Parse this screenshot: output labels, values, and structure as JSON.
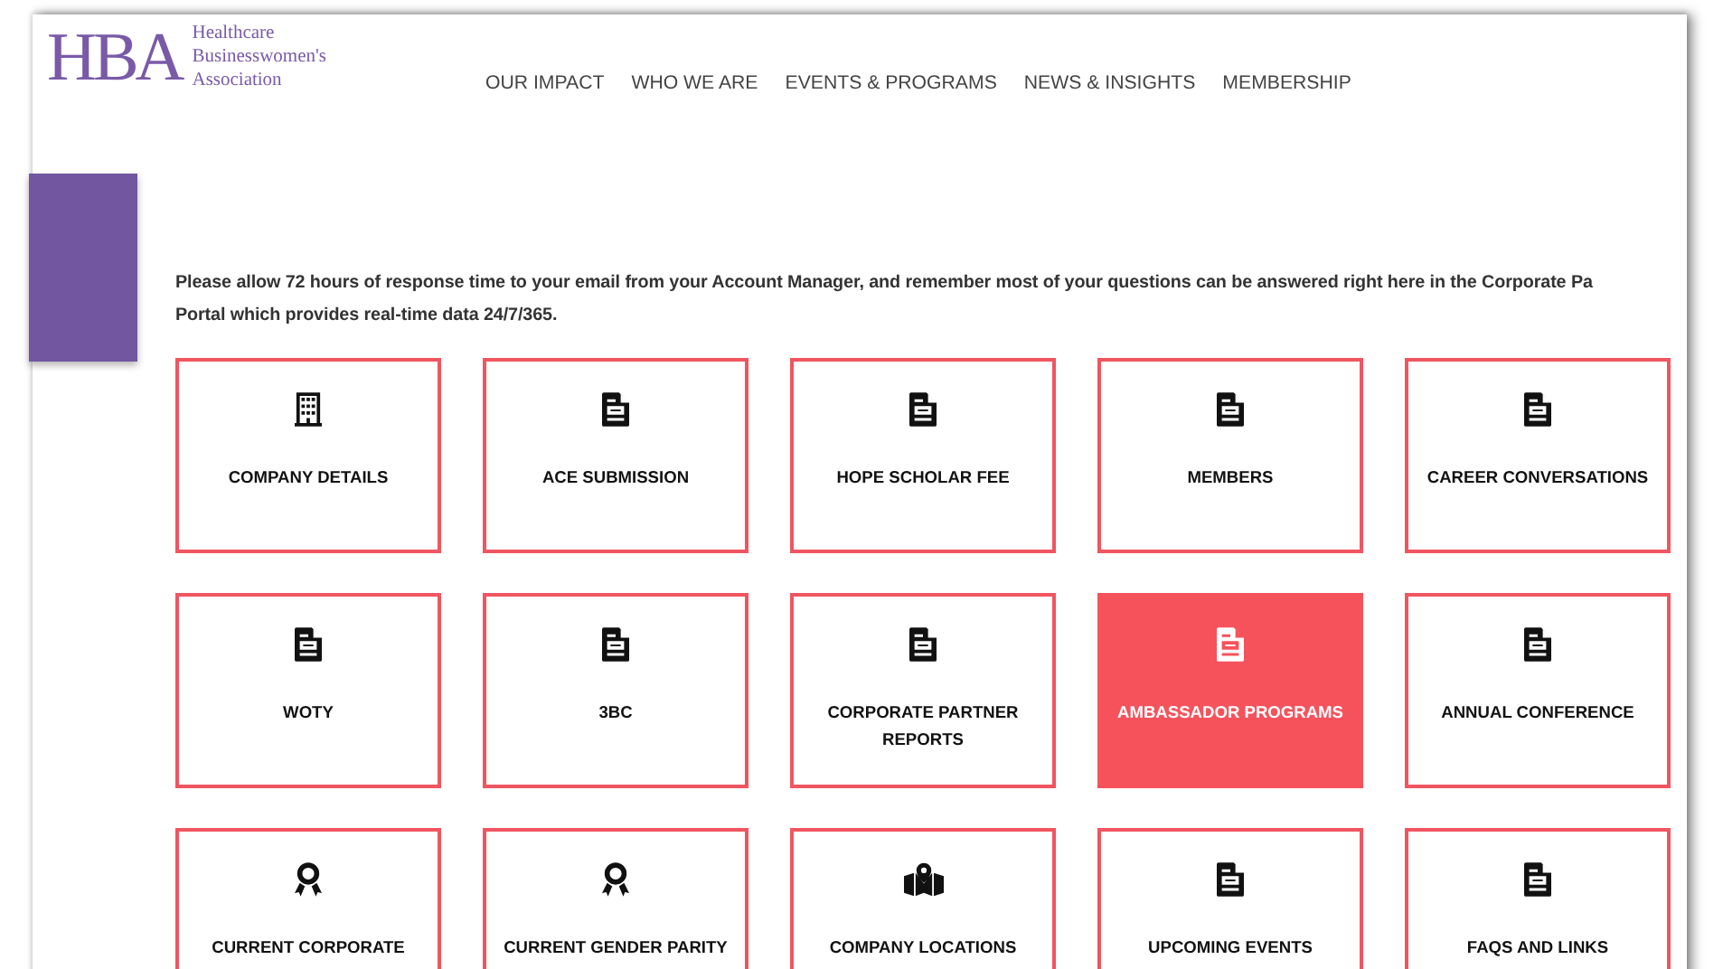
{
  "logo": {
    "mark": "HBA",
    "lines": [
      "Healthcare",
      "Businesswomen's",
      "Association"
    ]
  },
  "nav": [
    "OUR IMPACT",
    "WHO WE ARE",
    "EVENTS & PROGRAMS",
    "NEWS & INSIGHTS",
    "MEMBERSHIP"
  ],
  "intro_lines": [
    "Please allow 72 hours of response time to your email from your Account Manager, and remember most of your questions can be answered right here in the Corporate Pa",
    "Portal which provides real-time data 24/7/365."
  ],
  "tiles": [
    {
      "label": "COMPANY DETAILS",
      "kind": "building",
      "selected": false
    },
    {
      "label": "ACE SUBMISSION",
      "kind": "document",
      "selected": false
    },
    {
      "label": "HOPE SCHOLAR FEE",
      "kind": "document",
      "selected": false
    },
    {
      "label": "MEMBERS",
      "kind": "document",
      "selected": false
    },
    {
      "label": "CAREER CONVERSATIONS",
      "kind": "document",
      "selected": false
    },
    {
      "label": "WOTY",
      "kind": "document",
      "selected": false
    },
    {
      "label": "3BC",
      "kind": "document",
      "selected": false
    },
    {
      "label": "CORPORATE PARTNER REPORTS",
      "kind": "document",
      "selected": false
    },
    {
      "label": "AMBASSADOR PROGRAMS",
      "kind": "document",
      "selected": true
    },
    {
      "label": "ANNUAL CONFERENCE",
      "kind": "document",
      "selected": false
    },
    {
      "label": "CURRENT CORPORATE",
      "kind": "award",
      "selected": false
    },
    {
      "label": "CURRENT GENDER PARITY",
      "kind": "award",
      "selected": false
    },
    {
      "label": "COMPANY LOCATIONS",
      "kind": "map",
      "selected": false
    },
    {
      "label": "UPCOMING EVENTS",
      "kind": "document",
      "selected": false
    },
    {
      "label": "FAQS AND LINKS",
      "kind": "document",
      "selected": false
    }
  ]
}
